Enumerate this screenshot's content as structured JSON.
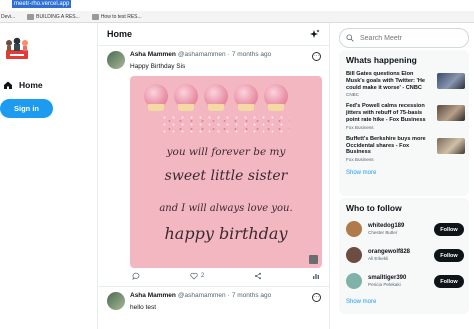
{
  "browser": {
    "url": "meetr-rho.vercel.app",
    "bookmarks": [
      "Devi...",
      "BUILDING A RES...",
      "How to test RES..."
    ]
  },
  "sidebar": {
    "home_label": "Home",
    "signin_label": "Sign in"
  },
  "feed": {
    "title": "Home",
    "posts": [
      {
        "name": "Asha Mammen",
        "handle": "@ashamammen",
        "separator": "·",
        "time": "7 months ago",
        "text": "Happy Birthday Sis",
        "image_lines": [
          "you will forever be my",
          "sweet little sister",
          "and I will always love you.",
          "happy birthday"
        ],
        "likes": "2"
      },
      {
        "name": "Asha Mammen",
        "handle": "@ashamammen",
        "separator": "·",
        "time": "7 months ago",
        "text": "hello test"
      }
    ]
  },
  "search": {
    "placeholder": "Search Meetr"
  },
  "trends": {
    "title": "Whats happening",
    "items": [
      {
        "title": "Bill Gates questions Elon Musk's goals with Twitter: 'He could make it worse' - CNBC",
        "source": "CNBC"
      },
      {
        "title": "Fed's Powell calms recession jitters with rebuff of 75-basis point rate hike - Fox Business",
        "source": "Fox Business"
      },
      {
        "title": "Buffett's Berkshire buys more Occidental shares - Fox Business",
        "source": "Fox Business"
      }
    ],
    "show_more": "Show more"
  },
  "who_to_follow": {
    "title": "Who to follow",
    "users": [
      {
        "handle": "whitedog189",
        "name": "Chester Butler",
        "avatar_color": "#b07a4a"
      },
      {
        "handle": "orangewolf828",
        "name": "Ali Erkekli",
        "avatar_color": "#6d4c41"
      },
      {
        "handle": "smalltiger390",
        "name": "Pericia Pelekaki",
        "avatar_color": "#7fb2a8"
      }
    ],
    "follow_label": "Follow",
    "show_more": "Show more"
  },
  "colors": {
    "accent": "#1d9bf0",
    "dark": "#0f1419",
    "muted": "#536471"
  }
}
